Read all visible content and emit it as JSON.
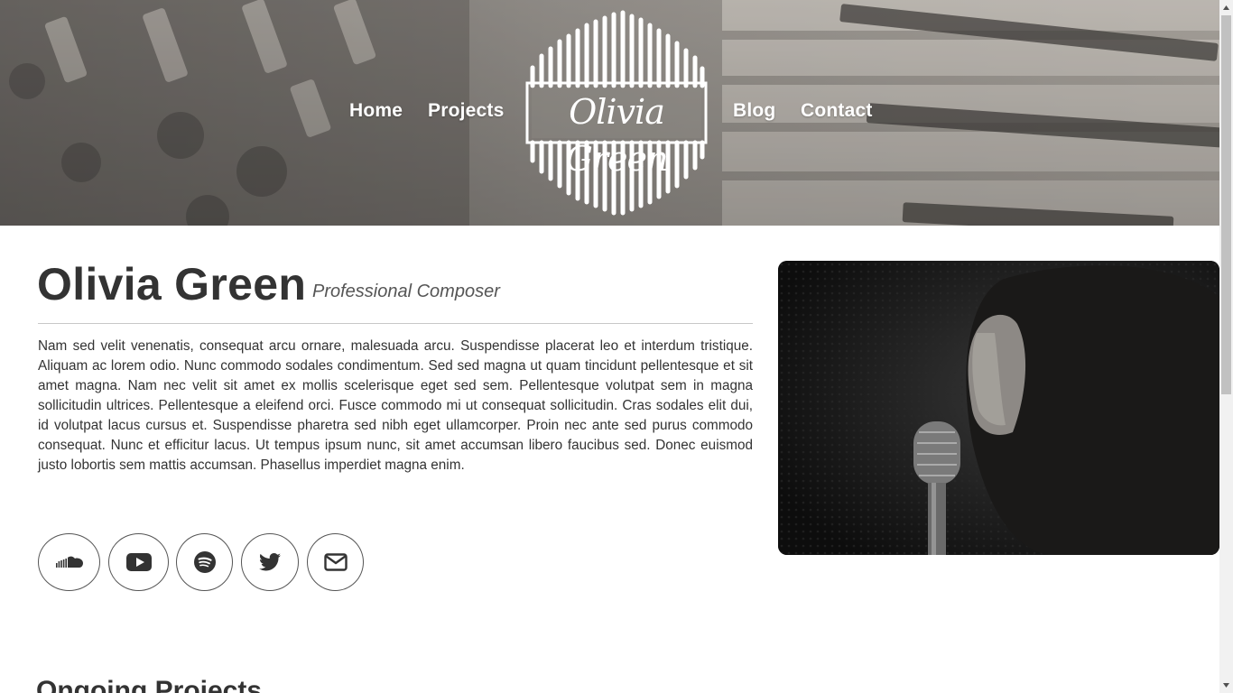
{
  "nav": {
    "home": "Home",
    "projects": "Projects",
    "blog": "Blog",
    "contact": "Contact"
  },
  "logo": {
    "text": "Olivia Green"
  },
  "profile": {
    "name": "Olivia Green",
    "subtitle": "Professional Composer",
    "bio": "Nam sed velit venenatis, consequat arcu ornare, malesuada arcu. Suspendisse placerat leo et interdum tristique. Aliquam ac lorem odio. Nunc commodo sodales condimentum. Sed sed magna ut quam tincidunt pellentesque et sit amet magna. Nam nec velit sit amet ex mollis scelerisque eget sed sem. Pellentesque volutpat sem in magna sollicitudin ultrices. Pellentesque a eleifend orci. Fusce commodo mi ut consequat sollicitudin. Cras sodales elit dui, id volutpat lacus cursus et. Suspendisse pharetra sed nibh eget ullamcorper. Proin nec ante sed purus commodo consequat. Nunc et efficitur lacus. Ut tempus ipsum nunc, sit amet accumsan libero faucibus sed. Donec euismod justo lobortis sem mattis accumsan. Phasellus imperdiet magna enim."
  },
  "social": [
    {
      "icon": "soundcloud-icon"
    },
    {
      "icon": "youtube-icon"
    },
    {
      "icon": "spotify-icon"
    },
    {
      "icon": "twitter-icon"
    },
    {
      "icon": "email-icon"
    }
  ],
  "sections": {
    "ongoing_heading": "Ongoing Projects"
  },
  "colors": {
    "text": "#333333",
    "hero_tint": "#8d8a86",
    "border": "#555555"
  }
}
